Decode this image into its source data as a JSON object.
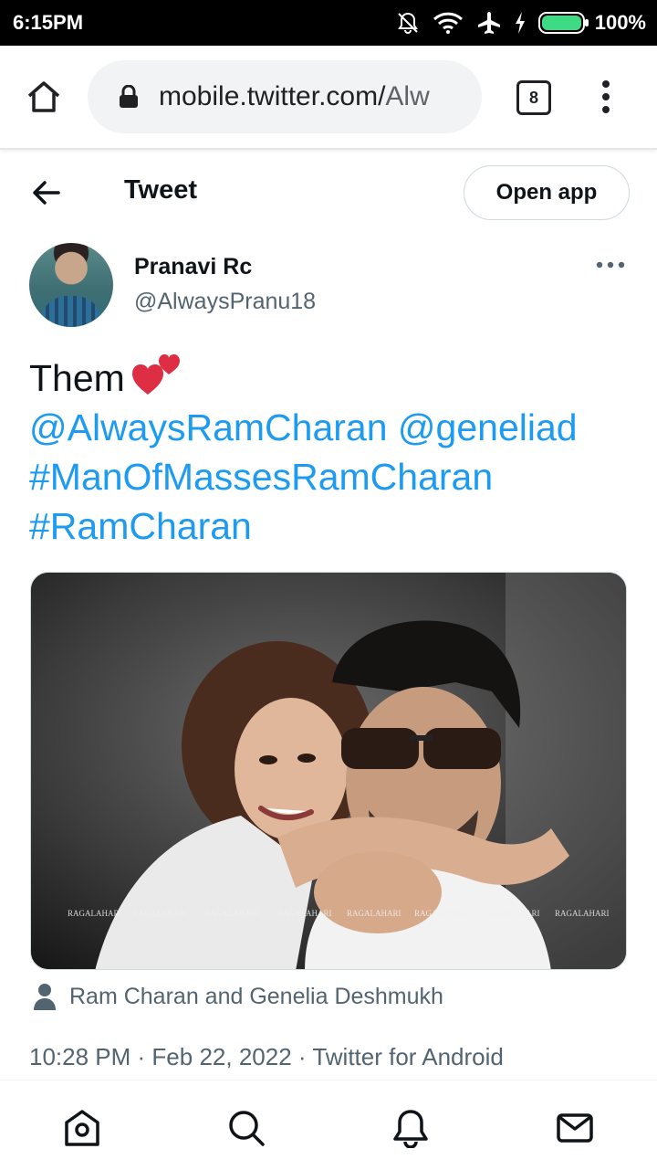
{
  "status_bar": {
    "time": "6:15PM",
    "battery": "100%",
    "icons": [
      "silent-icon",
      "wifi-icon",
      "airplane-icon",
      "charging-icon",
      "battery-icon"
    ]
  },
  "browser": {
    "url_host": "mobile.twitter.com/",
    "url_path": "Alw",
    "tab_count": "8"
  },
  "header": {
    "title": "Tweet",
    "open_app_label": "Open app"
  },
  "tweet": {
    "display_name": "Pranavi Rc",
    "handle": "@AlwaysPranu18",
    "text": "Them",
    "mentions": "@AlwaysRamCharan @geneliad",
    "hashtag_1": "#ManOfMassesRamCharan",
    "hashtag_2": "#RamCharan",
    "tagged_people": "Ram Charan and Genelia Deshmukh",
    "time": "10:28 PM",
    "date": "Feb 22, 2022",
    "source": "Twitter for Android"
  },
  "media": {
    "watermark": "RAGALAHARI"
  },
  "colors": {
    "link": "#1d9bf0",
    "secondary_text": "#536471",
    "primary_text": "#0f1419"
  },
  "bottom_nav": [
    "home-icon",
    "search-icon",
    "notifications-icon",
    "messages-icon"
  ]
}
